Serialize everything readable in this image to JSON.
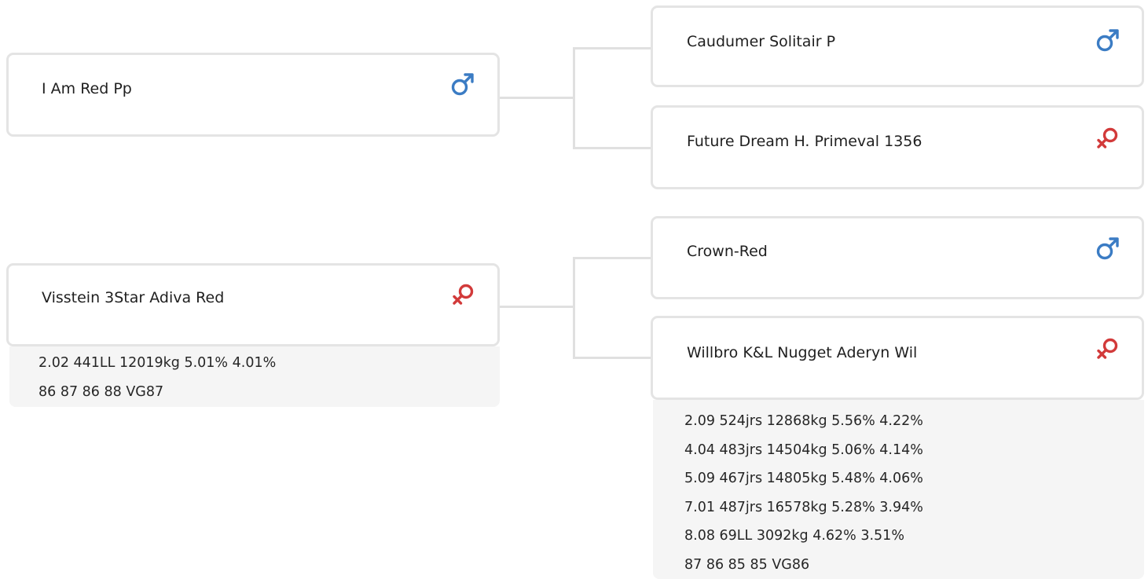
{
  "colors": {
    "male": "#3b7cc4",
    "female": "#d23a3a",
    "card_border": "#e4e4e4",
    "connector": "#e0e0e0",
    "info_bg": "#f5f5f5"
  },
  "tree": {
    "sire": {
      "name": "I Am Red Pp",
      "sex": "male-icon",
      "sire": {
        "name": "Caudumer Solitair P",
        "sex": "male-icon"
      },
      "dam": {
        "name": "Future Dream H. Primeval 1356",
        "sex": "female-icon"
      }
    },
    "dam": {
      "name": "Visstein 3Star Adiva Red",
      "sex": "female-icon",
      "stats": [
        "2.02 441LL 12019kg 5.01% 4.01%",
        "86 87 86 88 VG87"
      ],
      "sire": {
        "name": "Crown-Red",
        "sex": "male-icon"
      },
      "dam": {
        "name": "Willbro K&L Nugget Aderyn Wil",
        "sex": "female-icon",
        "stats": [
          "2.09 524jrs 12868kg 5.56% 4.22%",
          "4.04 483jrs 14504kg 5.06% 4.14%",
          "5.09 467jrs 14805kg 5.48% 4.06%",
          "7.01 487jrs 16578kg 5.28% 3.94%",
          "8.08 69LL 3092kg 4.62% 3.51%",
          "87 86 85 85 VG86"
        ]
      }
    }
  }
}
